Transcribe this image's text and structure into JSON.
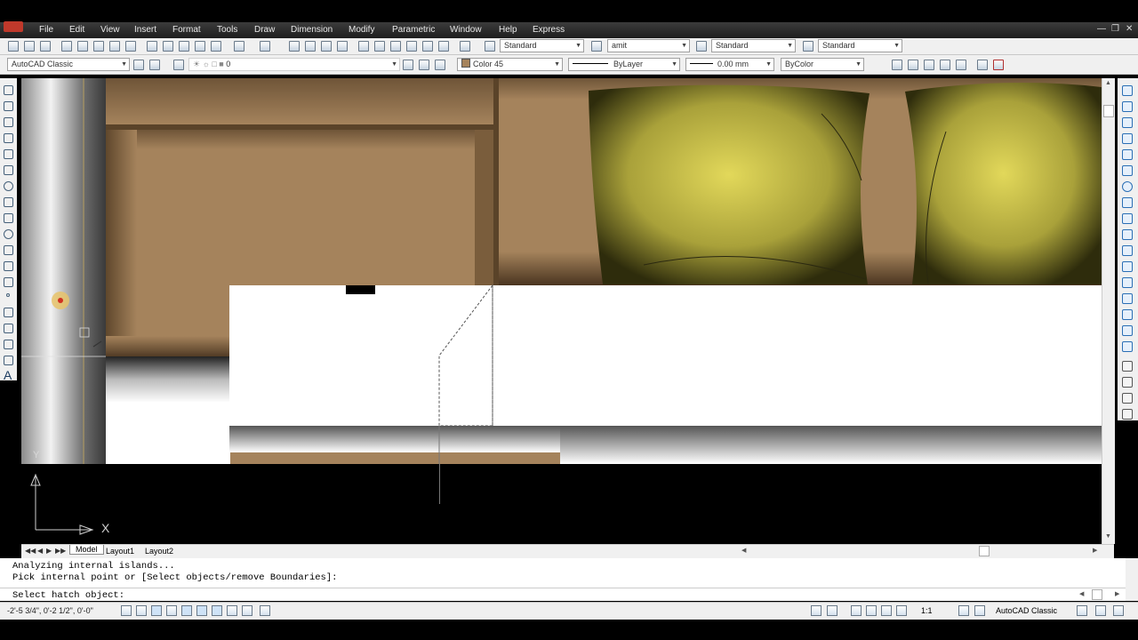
{
  "menu": {
    "items": [
      "File",
      "Edit",
      "View",
      "Insert",
      "Format",
      "Tools",
      "Draw",
      "Dimension",
      "Modify",
      "Parametric",
      "Window",
      "Help",
      "Express"
    ]
  },
  "toolbar1": {
    "text_style": "Standard",
    "dim_style": "amit",
    "table_style": "Standard",
    "multileader_style": "Standard"
  },
  "toolbar2": {
    "workspace": "AutoCAD Classic",
    "layer": "0",
    "color": "Color 45",
    "linetype": "ByLayer",
    "lineweight": "0.00 mm",
    "plot_style": "ByColor"
  },
  "layout_tabs": [
    "Model",
    "Layout1",
    "Layout2"
  ],
  "command": {
    "line1": "Analyzing internal islands...",
    "line2": "Pick internal point or [Select objects/remove Boundaries]:",
    "prompt": "Select hatch object:"
  },
  "status": {
    "coordinates": "-2'-5 3/4\", 0'-2 1/2\", 0'-0\"",
    "annotation_scale": "1:1",
    "workspace": "AutoCAD Classic"
  },
  "ucs": {
    "x_label": "X",
    "y_label": "Y"
  },
  "colors": {
    "menu_bg": "#2b2b2b",
    "toolbar_bg": "#f0f0f0",
    "wood": "#a5835c",
    "pillow": "#d8d055",
    "cushion": "#ffffff",
    "model_bg": "#000000"
  }
}
